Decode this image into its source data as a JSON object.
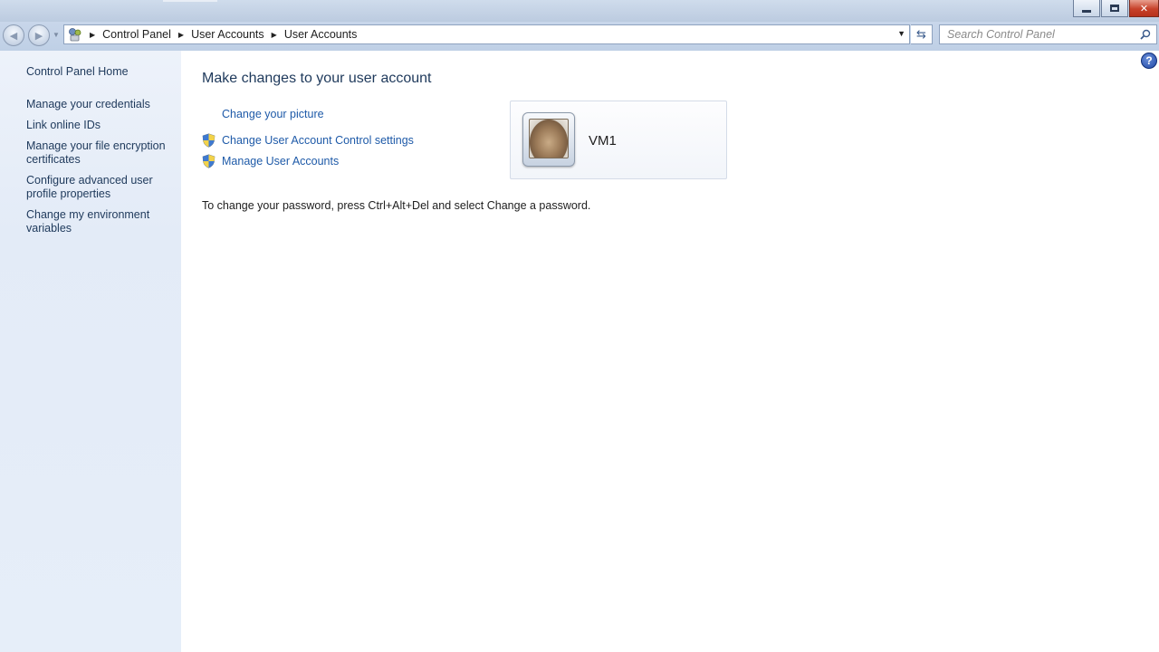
{
  "window": {
    "minimize_icon": "minimize-icon",
    "maximize_icon": "restore-icon",
    "close_icon": "close-icon"
  },
  "address": {
    "breadcrumbs": [
      "Control Panel",
      "User Accounts",
      "User Accounts"
    ],
    "search_placeholder": "Search Control Panel"
  },
  "sidebar": {
    "home": "Control Panel Home",
    "items": [
      "Manage your credentials",
      "Link online IDs",
      "Manage your file encryption certificates",
      "Configure advanced user profile properties",
      "Change my environment variables"
    ]
  },
  "main": {
    "title": "Make changes to your user account",
    "tasks": {
      "change_picture": "Change your picture",
      "uac_settings": "Change User Account Control settings",
      "manage_accounts": "Manage User Accounts"
    },
    "account": {
      "name": "VM1"
    },
    "password_info": "To change your password, press Ctrl+Alt+Del and select Change a password."
  },
  "colors": {
    "link": "#1e5aa8",
    "title": "#1e395b",
    "sidebar_bg": "#e6eef9"
  }
}
